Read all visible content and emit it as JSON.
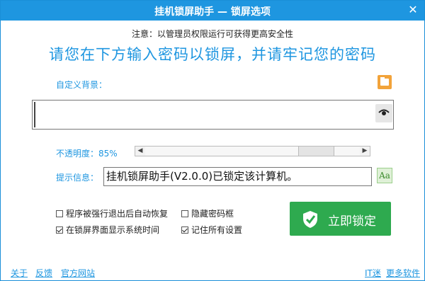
{
  "window": {
    "title": "挂机锁屏助手 — 锁屏选项",
    "close_glyph": "✕"
  },
  "notice": "注意：以管理员权限运行可获得更高安全性",
  "headline": "请您在下方输入密码以锁屏，并请牢记您的密码",
  "background": {
    "label": "自定义背景："
  },
  "password": {
    "value": ""
  },
  "opacity": {
    "label": "不透明度：85%",
    "value_percent": 85
  },
  "hint": {
    "label": "提示信息：",
    "value": "挂机锁屏助手(V2.0.0)已锁定该计算机。",
    "font_button": "Aa"
  },
  "options": [
    {
      "label": "程序被强行退出后自动恢复",
      "checked": false
    },
    {
      "label": "隐藏密码框",
      "checked": false
    },
    {
      "label": "在锁屏界面显示系统时间",
      "checked": true
    },
    {
      "label": "记住所有设置",
      "checked": true
    }
  ],
  "lock_button": "立即锁定",
  "footer": {
    "about": "关于",
    "feedback": "反馈",
    "website": "官方网站",
    "itmi": "IT迷",
    "more": "更多软件"
  },
  "colors": {
    "accent": "#1e96e0",
    "lock_green": "#2eaa4f",
    "folder_orange": "#f2a33a"
  }
}
